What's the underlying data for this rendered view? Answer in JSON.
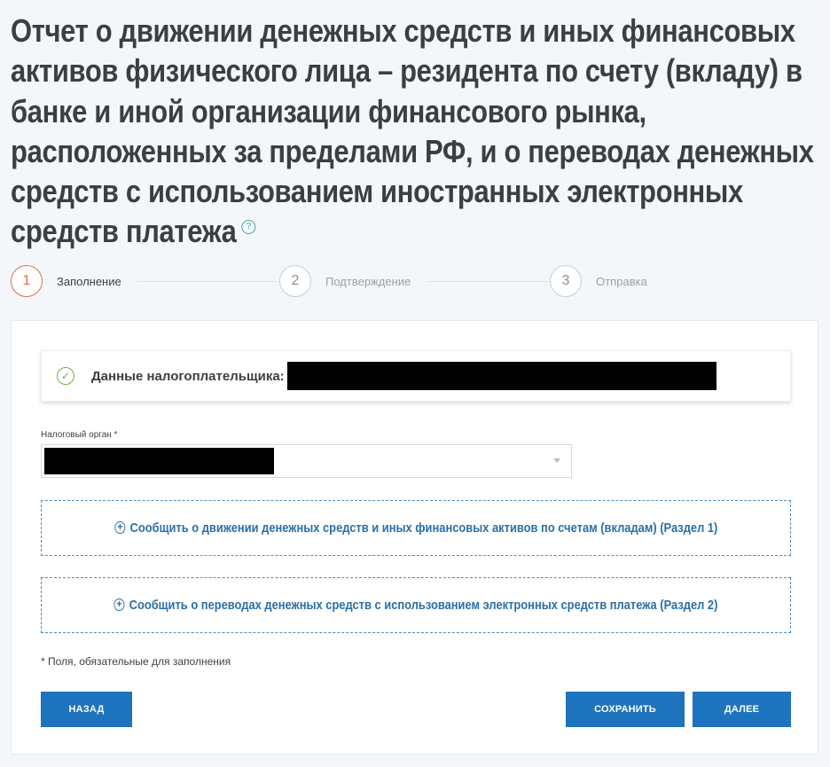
{
  "page": {
    "title": "Отчет о движении денежных средств и иных финансовых активов физического лица – резидента по счету (вкладу) в банке и иной организации финансового рынка, расположенных за пределами РФ, и о переводах денежных средств с использованием иностранных электронных средств платежа",
    "help_icon": "?"
  },
  "stepper": {
    "steps": [
      {
        "number": "1",
        "label": "Заполнение",
        "state": "active"
      },
      {
        "number": "2",
        "label": "Подтверждение",
        "state": "pending"
      },
      {
        "number": "3",
        "label": "Отправка",
        "state": "pending"
      }
    ]
  },
  "form": {
    "taxpayer_label": "Данные налогоплательщика:",
    "tax_authority_label": "Налоговый орган *",
    "section1_button": "Сообщить о движении денежных средств и иных финансовых активов по счетам (вкладам) (Раздел 1)",
    "section2_button": "Сообщить о переводах денежных средств с использованием электронных средств платежа (Раздел 2)",
    "required_note": "* Поля, обязательные для заполнения"
  },
  "buttons": {
    "back": "НАЗАД",
    "save": "СОХРАНИТЬ",
    "next": "ДАЛЕЕ"
  },
  "colors": {
    "accent": "#1e73be",
    "active_step": "#e0704a",
    "success": "#6db33f",
    "background": "#f3f7fa"
  },
  "icons": {
    "taxpayer_status": "check-circle-icon",
    "add_section": "plus-circle-icon",
    "select_arrow": "chevron-down-icon",
    "help": "help-icon"
  }
}
